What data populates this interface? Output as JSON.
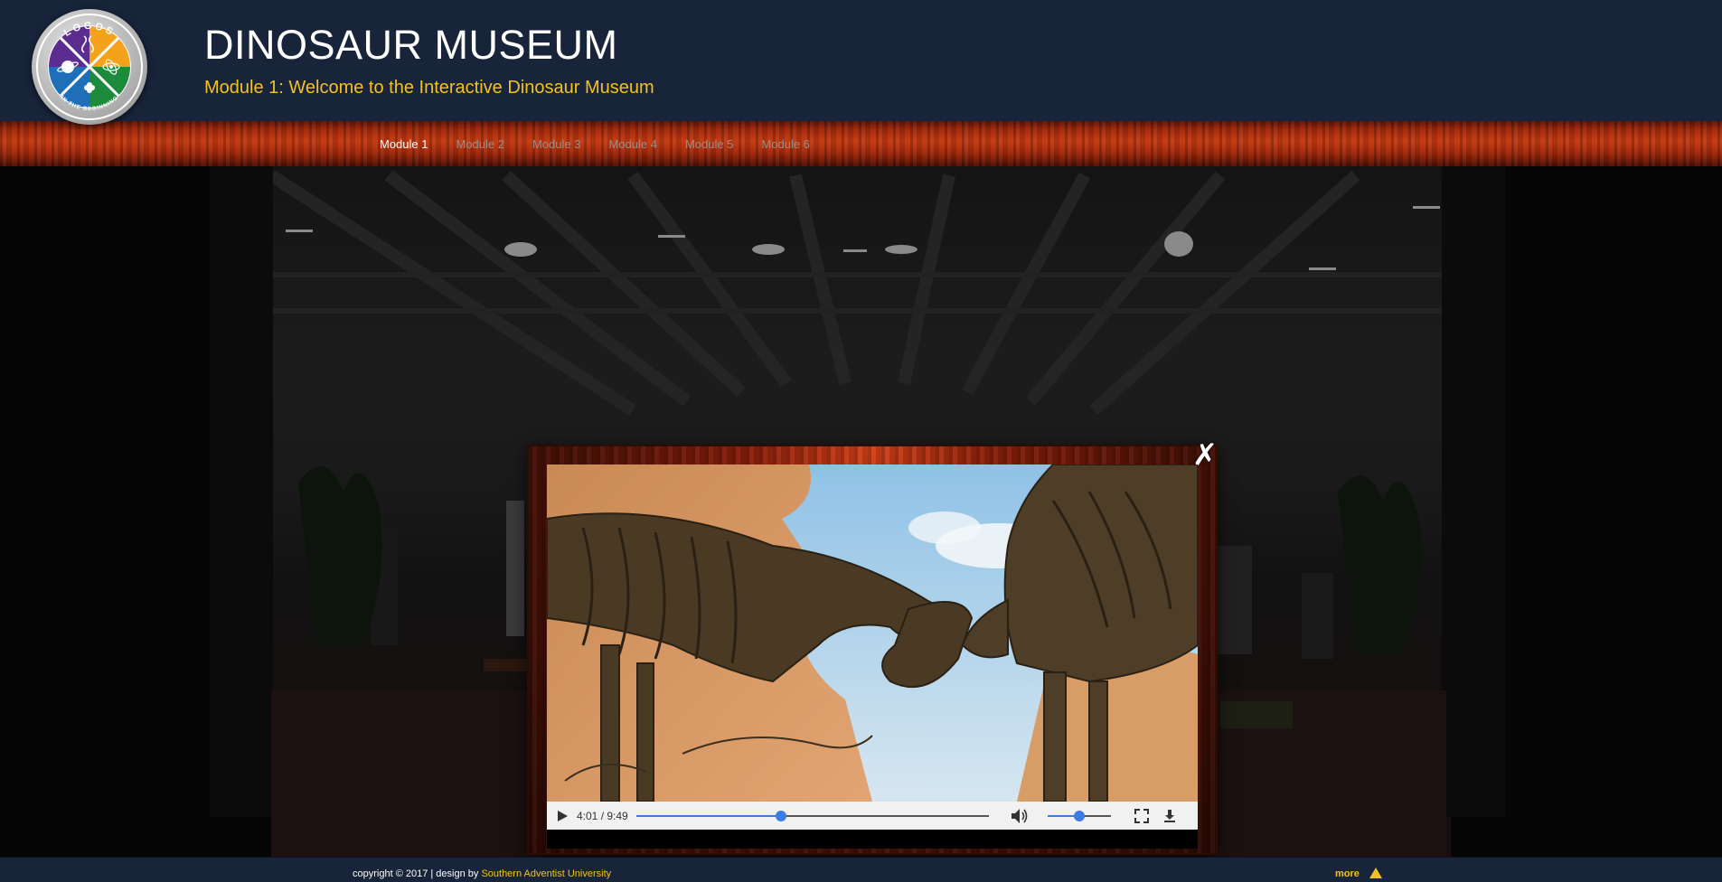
{
  "header": {
    "title": "DINOSAUR MUSEUM",
    "subtitle": "Module 1: Welcome to the Interactive Dinosaur Museum",
    "logo": {
      "top_text": "LOGOS",
      "bottom_text": "IN THE BEGINNING",
      "quadrant_colors": [
        "#5b2d90",
        "#f4a21c",
        "#1e8a3c",
        "#1f6fb8"
      ]
    }
  },
  "nav": {
    "items": [
      {
        "label": "Module 1",
        "active": true
      },
      {
        "label": "Module 2",
        "active": false
      },
      {
        "label": "Module 3",
        "active": false
      },
      {
        "label": "Module 4",
        "active": false
      },
      {
        "label": "Module 5",
        "active": false
      },
      {
        "label": "Module 6",
        "active": false
      }
    ]
  },
  "video_modal": {
    "close_icon": "x-close-icon",
    "player": {
      "time_display": "4:01 / 9:49",
      "progress_fraction": 0.409,
      "volume_fraction": 0.5,
      "icons": [
        "play-icon",
        "volume-icon",
        "fullscreen-icon",
        "download-icon"
      ]
    }
  },
  "footer": {
    "copyright_prefix": "copyright © 2017 | design by ",
    "credit_link": "Southern Adventist University",
    "more_label": "more",
    "more_icon": "triangle-up-icon"
  },
  "colors": {
    "header_bg": "#18243a",
    "accent_yellow": "#f4c21c",
    "nav_wood": "#c23a12",
    "player_accent": "#3b7de4"
  }
}
